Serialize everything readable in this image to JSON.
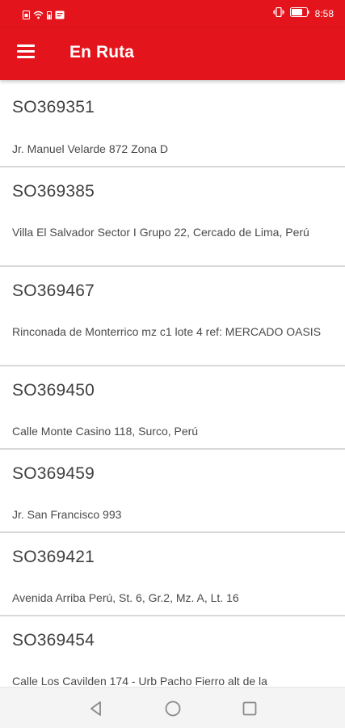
{
  "status_bar": {
    "time": "8:58"
  },
  "app_bar": {
    "title": "En Ruta"
  },
  "orders": [
    {
      "id": "SO369351",
      "address": "Jr. Manuel Velarde 872 Zona D"
    },
    {
      "id": "SO369385",
      "address": "Villa El Salvador Sector I Grupo 22, Cercado de Lima, Perú"
    },
    {
      "id": "SO369467",
      "address": "Rinconada de Monterrico mz c1 lote 4 ref: MERCADO OASIS"
    },
    {
      "id": "SO369450",
      "address": "Calle Monte Casino 118, Surco, Perú"
    },
    {
      "id": "SO369459",
      "address": "Jr. San Francisco 993"
    },
    {
      "id": "SO369421",
      "address": "Avenida Arriba Perú, St. 6, Gr.2, Mz. A, Lt. 16"
    },
    {
      "id": "SO369454",
      "address": "Calle Los Cavilden 174 - Urb Pacho Fierro alt de la"
    }
  ],
  "colors": {
    "primary": "#e3141c",
    "divider": "#d8d8d8",
    "text_primary": "#404040",
    "text_secondary": "#4a4a4a"
  },
  "icons": {
    "menu": "menu-icon",
    "back": "back-icon",
    "home": "home-icon",
    "recents": "recents-icon"
  }
}
